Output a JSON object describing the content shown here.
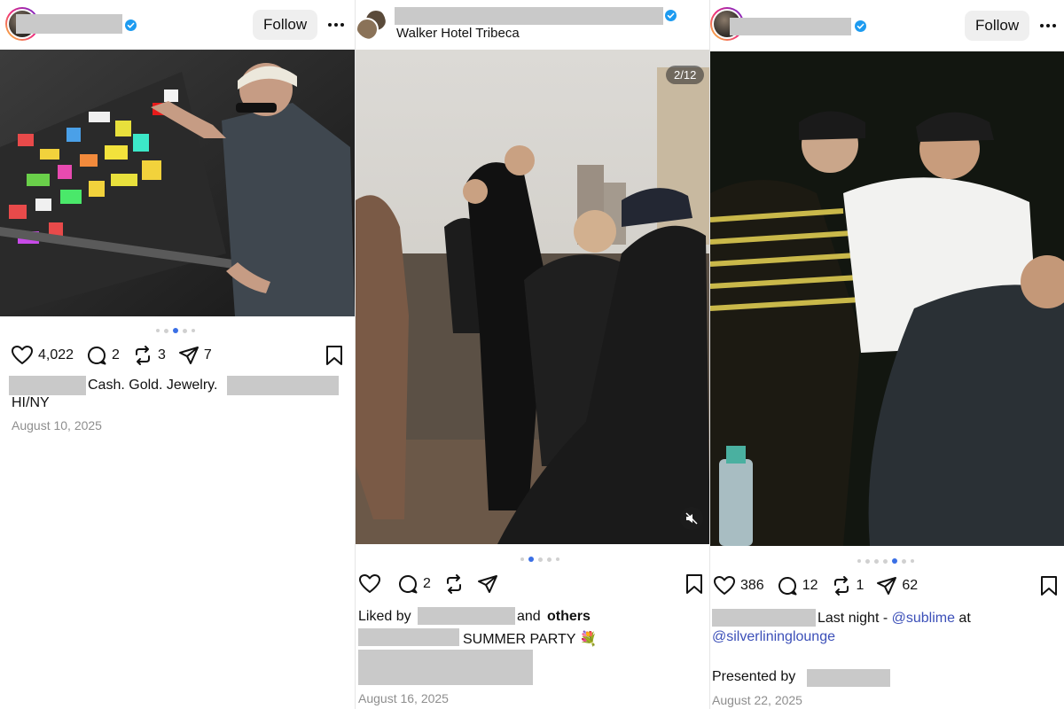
{
  "posts": [
    {
      "follow_label": "Follow",
      "photo_alt": "Man with bleached hair and sunglasses placing a sticker on a sticker-covered ledge",
      "actions": {
        "likes": "4,022",
        "comments": "2",
        "reposts": "3",
        "shares": "7"
      },
      "caption": {
        "line1": "Cash. Gold. Jewelry.",
        "line2": "HI/NY"
      },
      "date": "August 10, 2025"
    },
    {
      "location": "Walker Hotel Tribeca",
      "media_counter": "2/12",
      "photo_alt": "People gathered at a rooftop party at sunset",
      "actions": {
        "comments": "2"
      },
      "caption": {
        "liked_by_prefix": "Liked by",
        "liked_by_suffix_and": "and",
        "liked_by_others": "others",
        "line2": "SUMMER PARTY 💐"
      },
      "date": "August 16, 2025"
    },
    {
      "follow_label": "Follow",
      "photo_alt": "Three men sitting together at night, flash photo",
      "actions": {
        "likes": "386",
        "comments": "12",
        "reposts": "1",
        "shares": "62"
      },
      "caption": {
        "line1_text": "Last night - ",
        "mention1": "@sublime",
        "at": " at",
        "mention2": "@silverlininglounge",
        "presented_by": "Presented by"
      },
      "date": "August 22, 2025"
    }
  ],
  "colors": {
    "verified": "#1d9bf0",
    "mention": "#3b4fb8",
    "active_dot": "#3a6fe5",
    "date": "#8e8e8e"
  }
}
